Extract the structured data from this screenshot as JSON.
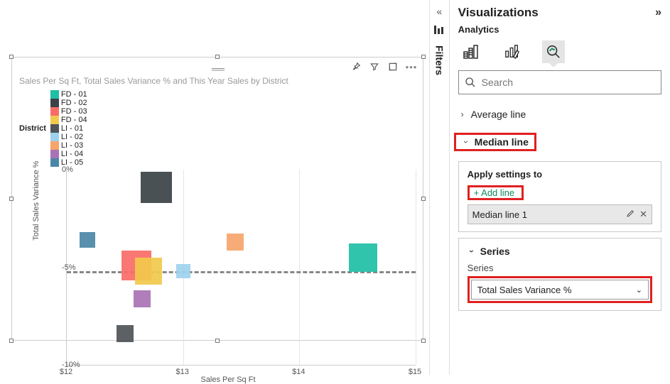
{
  "filters_label": "Filters",
  "panel": {
    "title": "Visualizations",
    "subtitle": "Analytics",
    "search_placeholder": "Search",
    "avg_line": "Average line",
    "median_line": "Median line",
    "apply_settings": "Apply settings to",
    "add_line": "+ Add line",
    "line_name": "Median line 1",
    "series_section": "Series",
    "series_label": "Series",
    "series_value": "Total Sales Variance %"
  },
  "chart": {
    "title": "Sales Per Sq Ft, Total Sales Variance % and This Year Sales by District",
    "legend_title": "District",
    "xaxis": "Sales Per Sq Ft",
    "yaxis": "Total Sales Variance %"
  },
  "chart_data": {
    "type": "scatter",
    "xlabel": "Sales Per Sq Ft",
    "ylabel": "Total Sales Variance %",
    "xlim": [
      12,
      15
    ],
    "ylim": [
      -10,
      0
    ],
    "x_ticks": [
      "$12",
      "$13",
      "$14",
      "$15"
    ],
    "y_ticks": [
      "0%",
      "-5%",
      "-10%"
    ],
    "median_y": -5.2,
    "series": [
      {
        "name": "FD - 01",
        "color": "#1fbfa5",
        "x": 14.55,
        "y": -4.5,
        "size": 40
      },
      {
        "name": "FD - 02",
        "color": "#3a4247",
        "x": 12.77,
        "y": -0.9,
        "size": 44
      },
      {
        "name": "FD - 03",
        "color": "#fa6c67",
        "x": 12.6,
        "y": -4.9,
        "size": 42
      },
      {
        "name": "FD - 04",
        "color": "#f2c94c",
        "x": 12.7,
        "y": -5.2,
        "size": 38
      },
      {
        "name": "LI - 01",
        "color": "#4f5459",
        "x": 12.5,
        "y": -8.4,
        "size": 24
      },
      {
        "name": "LI - 02",
        "color": "#9ed1ef",
        "x": 13.0,
        "y": -5.2,
        "size": 20
      },
      {
        "name": "LI - 03",
        "color": "#f6a56b",
        "x": 13.45,
        "y": -3.7,
        "size": 24
      },
      {
        "name": "LI - 04",
        "color": "#a873b5",
        "x": 12.65,
        "y": -6.6,
        "size": 24
      },
      {
        "name": "LI - 05",
        "color": "#4a87a6",
        "x": 12.18,
        "y": -3.6,
        "size": 22
      }
    ]
  }
}
